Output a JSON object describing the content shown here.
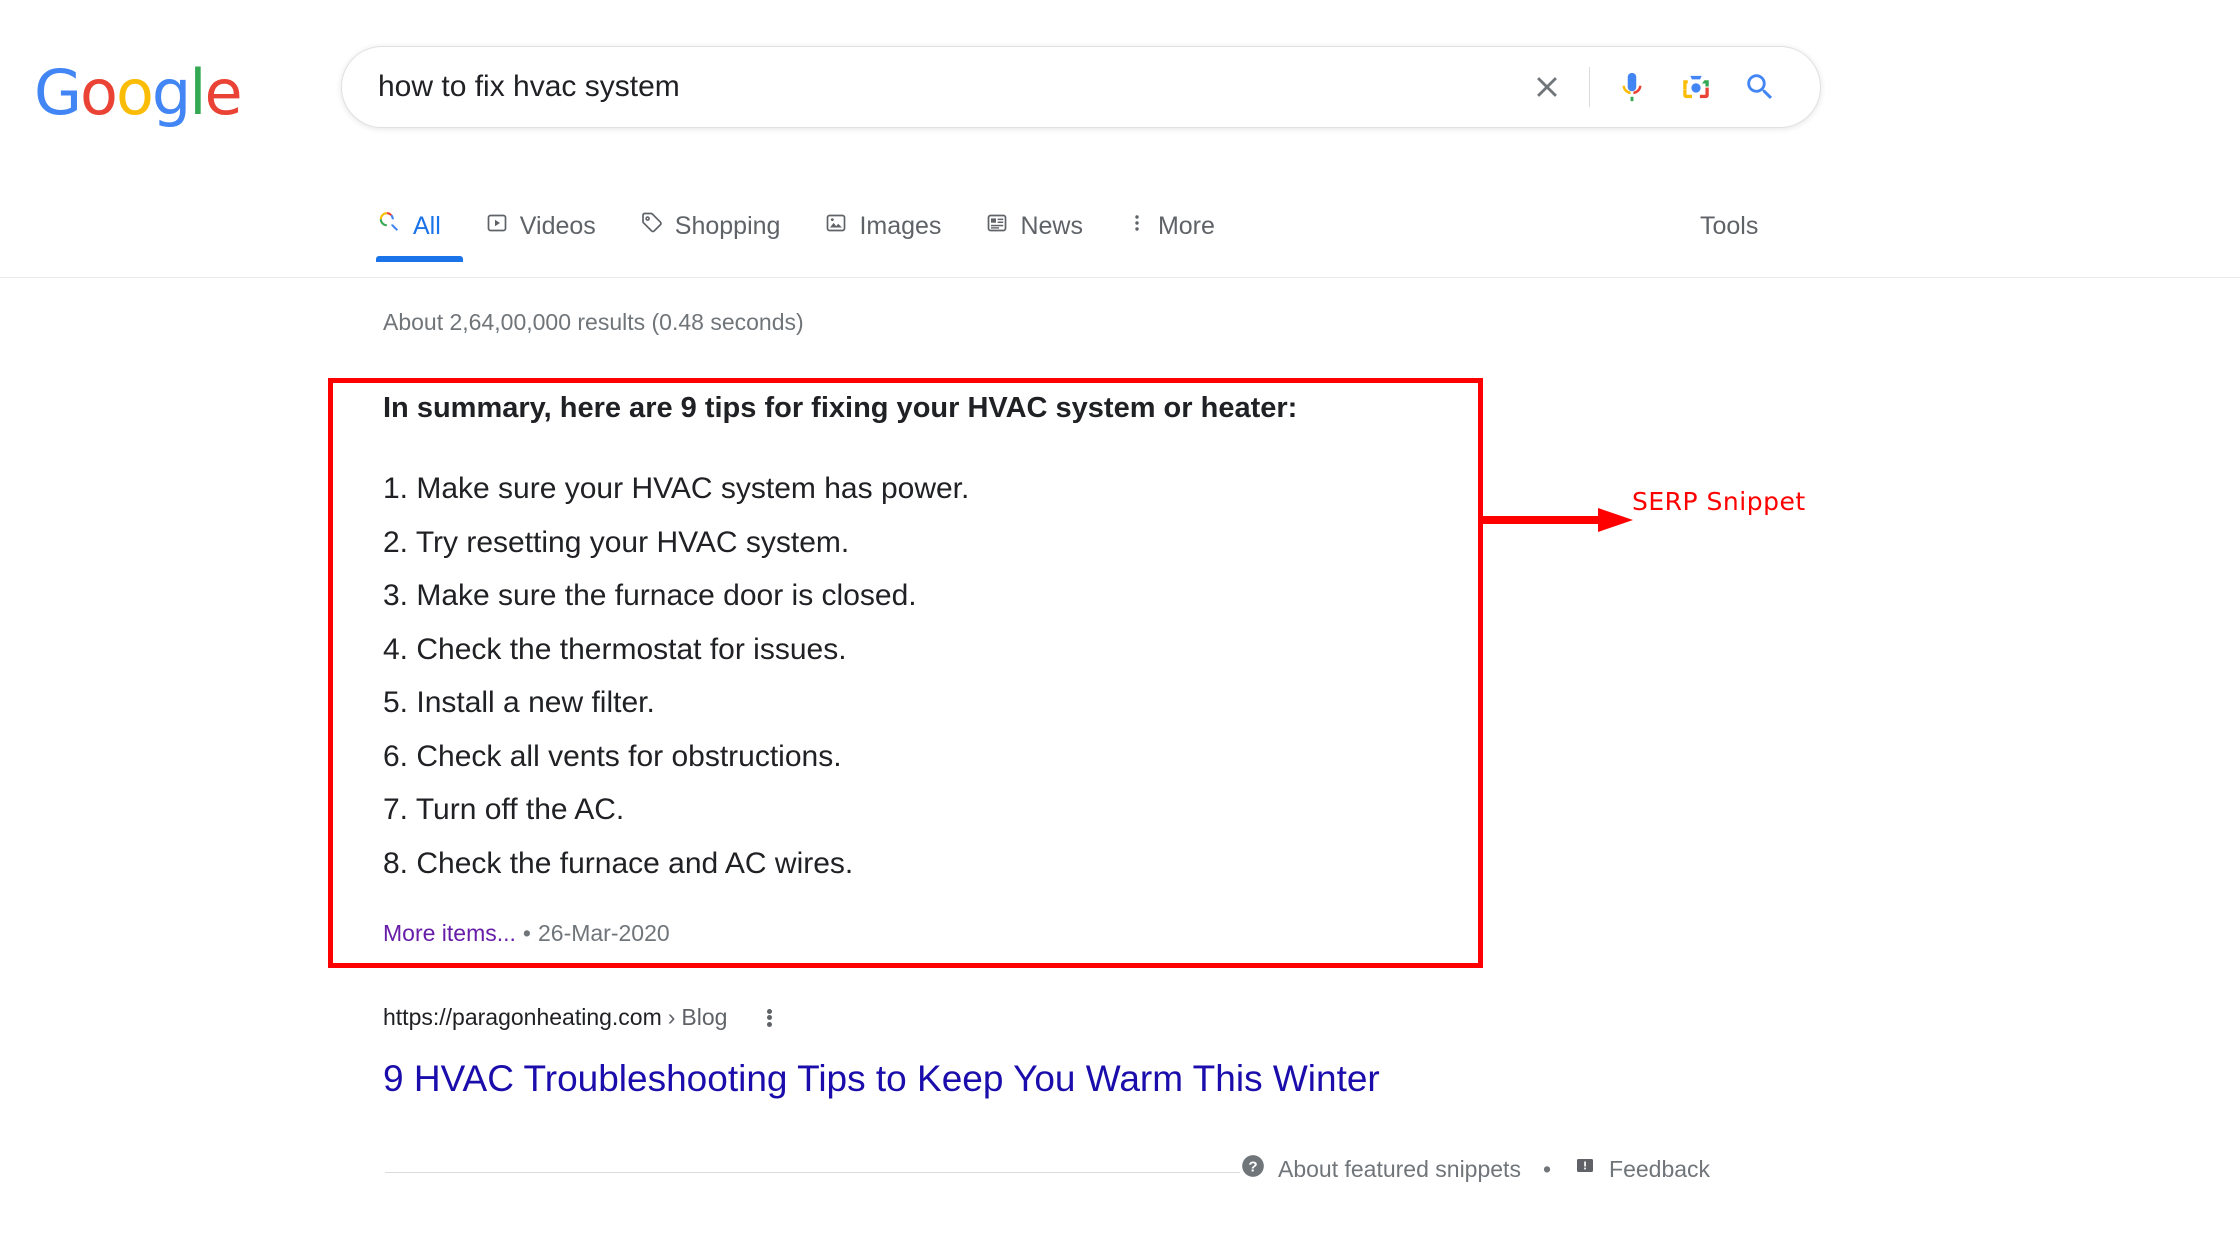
{
  "brand": {
    "name": "Google",
    "letters": [
      {
        "ch": "G",
        "color": "#4285F4"
      },
      {
        "ch": "o",
        "color": "#EA4335"
      },
      {
        "ch": "o",
        "color": "#FBBC05"
      },
      {
        "ch": "g",
        "color": "#4285F4"
      },
      {
        "ch": "l",
        "color": "#34A853"
      },
      {
        "ch": "e",
        "color": "#EA4335"
      }
    ]
  },
  "search": {
    "value": "how to fix hvac system",
    "placeholder": "Search",
    "icons": [
      "clear-icon",
      "microphone-icon",
      "google-lens-icon",
      "search-icon"
    ]
  },
  "nav": {
    "tabs": [
      {
        "label": "All",
        "icon": "google-search-icon",
        "active": true
      },
      {
        "label": "Videos",
        "icon": "video-icon",
        "active": false
      },
      {
        "label": "Shopping",
        "icon": "tag-icon",
        "active": false
      },
      {
        "label": "Images",
        "icon": "image-icon",
        "active": false
      },
      {
        "label": "News",
        "icon": "news-icon",
        "active": false
      },
      {
        "label": "More",
        "icon": "more-vertical-icon",
        "active": false
      }
    ],
    "tools_label": "Tools"
  },
  "results": {
    "count_text": "About 2,64,00,000 results (0.48 seconds)"
  },
  "snippet": {
    "heading": "In summary, here are 9 tips for fixing your HVAC system or heater:",
    "items": [
      "1. Make sure your HVAC system has power.",
      "2. Try resetting your HVAC system.",
      "3. Make sure the furnace door is closed.",
      "4. Check the thermostat for issues.",
      "5. Install a new filter.",
      "6. Check all vents for obstructions.",
      "7. Turn off the AC.",
      "8. Check the furnace and AC wires."
    ],
    "more_items_label": "More items...",
    "separator": "•",
    "date": "26-Mar-2020"
  },
  "result": {
    "url_domain": "https://paragonheating.com",
    "url_separator": "›",
    "url_crumb": "Blog",
    "title": "9 HVAC Troubleshooting Tips to Keep You Warm This Winter"
  },
  "footer": {
    "about_label": "About featured snippets",
    "separator": "•",
    "feedback_label": "Feedback"
  },
  "annotation": {
    "label": "SERP Snippet",
    "color": "#FF0000"
  }
}
